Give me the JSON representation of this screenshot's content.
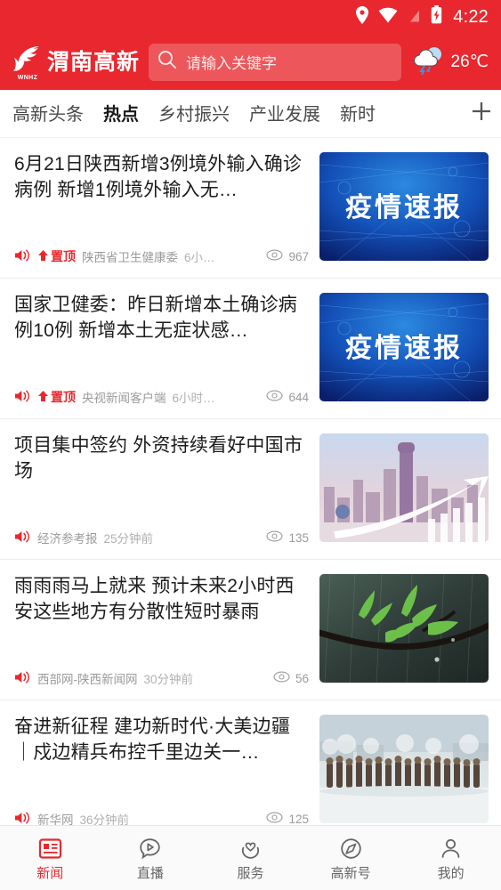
{
  "colors": {
    "brand_red": "#E8282E",
    "title_text": "#1c1c1c",
    "meta_gray": "#9b9b9b"
  },
  "statusbar": {
    "time": "4:22",
    "icons": [
      "location-pin-icon",
      "wifi-icon",
      "no-signal-icon",
      "battery-charging-icon"
    ]
  },
  "header": {
    "logo_text": "渭南高新",
    "logo_subtext": "WNHZ",
    "search": {
      "placeholder": "请输入关键字",
      "icon": "search-icon"
    },
    "weather": {
      "temperature": "26℃",
      "icon": "thunderstorm-icon"
    }
  },
  "tabs": {
    "items": [
      {
        "label": "高新头条",
        "active": false
      },
      {
        "label": "热点",
        "active": true
      },
      {
        "label": "乡村振兴",
        "active": false
      },
      {
        "label": "产业发展",
        "active": false
      },
      {
        "label": "新时",
        "active": false
      }
    ],
    "add_label": "+"
  },
  "news": {
    "items": [
      {
        "title": "6月21日陕西新增3例境外输入确诊病例 新增1例境外输入无…",
        "pinned": true,
        "pin_label": "置顶",
        "source": "陕西省卫生健康委",
        "time": "6小…",
        "views": "967",
        "audio_icon": "speaker-icon",
        "views_icon": "eye-icon",
        "thumb": "epidemic-report-blue",
        "thumb_text": "疫情速报"
      },
      {
        "title": "国家卫健委：昨日新增本土确诊病例10例 新增本土无症状感…",
        "pinned": true,
        "pin_label": "置顶",
        "source": "央视新闻客户端",
        "time": "6小时…",
        "views": "644",
        "audio_icon": "speaker-icon",
        "views_icon": "eye-icon",
        "thumb": "epidemic-report-blue",
        "thumb_text": "疫情速报"
      },
      {
        "title": "项目集中签约 外资持续看好中国市场",
        "pinned": false,
        "pin_label": "",
        "source": "经济参考报",
        "time": "25分钟前",
        "views": "135",
        "audio_icon": "speaker-icon",
        "views_icon": "eye-icon",
        "thumb": "city-skyline-arrow",
        "thumb_text": ""
      },
      {
        "title": "雨雨雨马上就来 预计未来2小时西安这些地方有分散性短时暴雨",
        "pinned": false,
        "pin_label": "",
        "source": "西部网-陕西新闻网",
        "time": "30分钟前",
        "views": "56",
        "audio_icon": "speaker-icon",
        "views_icon": "eye-icon",
        "thumb": "rain-leaves-branch",
        "thumb_text": ""
      },
      {
        "title": "奋进新征程 建功新时代·大美边疆｜戍边精兵布控千里边关一…",
        "pinned": false,
        "pin_label": "",
        "source": "新华网",
        "time": "36分钟前",
        "views": "125",
        "audio_icon": "speaker-icon",
        "views_icon": "eye-icon",
        "thumb": "soldiers-snow-formation",
        "thumb_text": ""
      }
    ]
  },
  "bottomnav": {
    "items": [
      {
        "label": "新闻",
        "icon": "news-grid-icon",
        "active": true
      },
      {
        "label": "直播",
        "icon": "live-play-bubble-icon",
        "active": false
      },
      {
        "label": "服务",
        "icon": "hands-heart-icon",
        "active": false
      },
      {
        "label": "高新号",
        "icon": "compass-icon",
        "active": false
      },
      {
        "label": "我的",
        "icon": "person-icon",
        "active": false
      }
    ]
  }
}
